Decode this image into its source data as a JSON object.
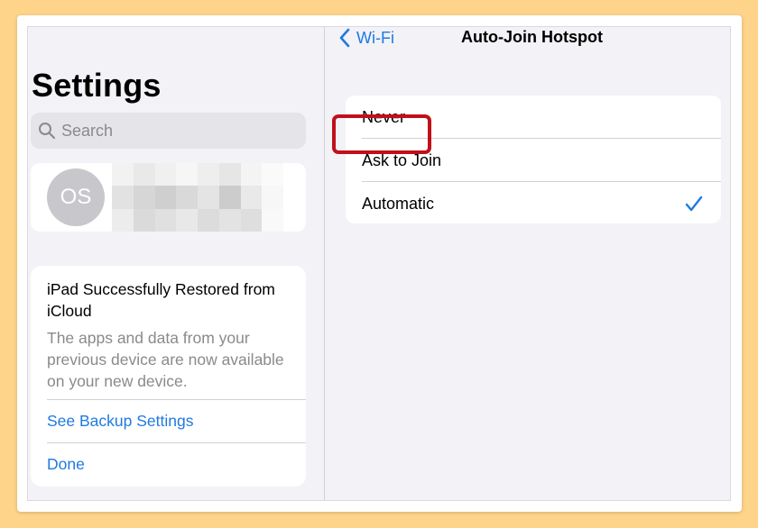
{
  "sidebar": {
    "title": "Settings",
    "search_placeholder": "Search",
    "profile_initials": "OS",
    "notice": {
      "title": "iPad Successfully Restored from iCloud",
      "body": "The apps and data from your previous device are now available on your new device.",
      "link1": "See Backup Settings",
      "link2": "Done"
    }
  },
  "detail": {
    "back_label": "Wi-Fi",
    "title": "Auto-Join Hotspot",
    "options": [
      {
        "label": "Never",
        "selected": false
      },
      {
        "label": "Ask to Join",
        "selected": false
      },
      {
        "label": "Automatic",
        "selected": true
      }
    ]
  },
  "colors": {
    "accent": "#1f7ae0",
    "highlight": "#c0101a",
    "background": "#fdd48a"
  },
  "icons": {
    "search": "magnifier-icon",
    "back": "chevron-left-icon",
    "check": "checkmark-icon"
  }
}
